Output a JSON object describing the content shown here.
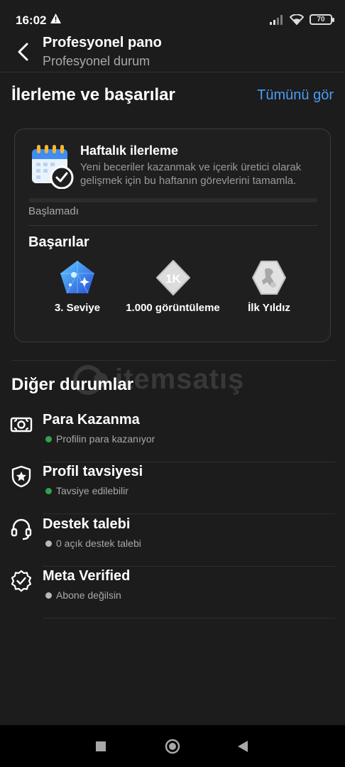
{
  "status": {
    "time": "16:02",
    "battery": "70"
  },
  "header": {
    "title": "Profesyonel pano",
    "subtitle": "Profesyonel durum"
  },
  "progress_section": {
    "title": "İlerleme ve başarılar",
    "see_all": "Tümünü gör",
    "weekly": {
      "title": "Haftalık ilerleme",
      "description": "Yeni beceriler kazanmak ve içerik üretici olarak gelişmek için bu haftanın görevlerini tamamla.",
      "progress": 0,
      "status": "Başlamadı"
    },
    "achievements": {
      "title": "Başarılar",
      "items": [
        {
          "label": "3. Seviye",
          "icon": "level-gem-icon"
        },
        {
          "label": "1.000 görüntüleme",
          "icon": "views-1k-badge-icon",
          "badge_text": "1K"
        },
        {
          "label": "İlk Yıldız",
          "icon": "first-star-badge-icon"
        }
      ]
    }
  },
  "other_section": {
    "title": "Diğer durumlar",
    "watermark": "itemsatış",
    "items": [
      {
        "title": "Para Kazanma",
        "status": "Profilin para kazanıyor",
        "status_color": "#31a24c",
        "icon": "money-icon"
      },
      {
        "title": "Profil tavsiyesi",
        "status": "Tavsiye edilebilir",
        "status_color": "#31a24c",
        "icon": "shield-star-icon"
      },
      {
        "title": "Destek talebi",
        "status": "0 açık destek talebi",
        "status_color": "#b8b8b8",
        "icon": "headset-icon"
      },
      {
        "title": "Meta Verified",
        "status": "Abone değilsin",
        "status_color": "#b8b8b8",
        "icon": "verified-badge-icon"
      }
    ]
  },
  "colors": {
    "accent": "#4a9cf5",
    "background": "#1c1c1c",
    "success": "#31a24c"
  }
}
